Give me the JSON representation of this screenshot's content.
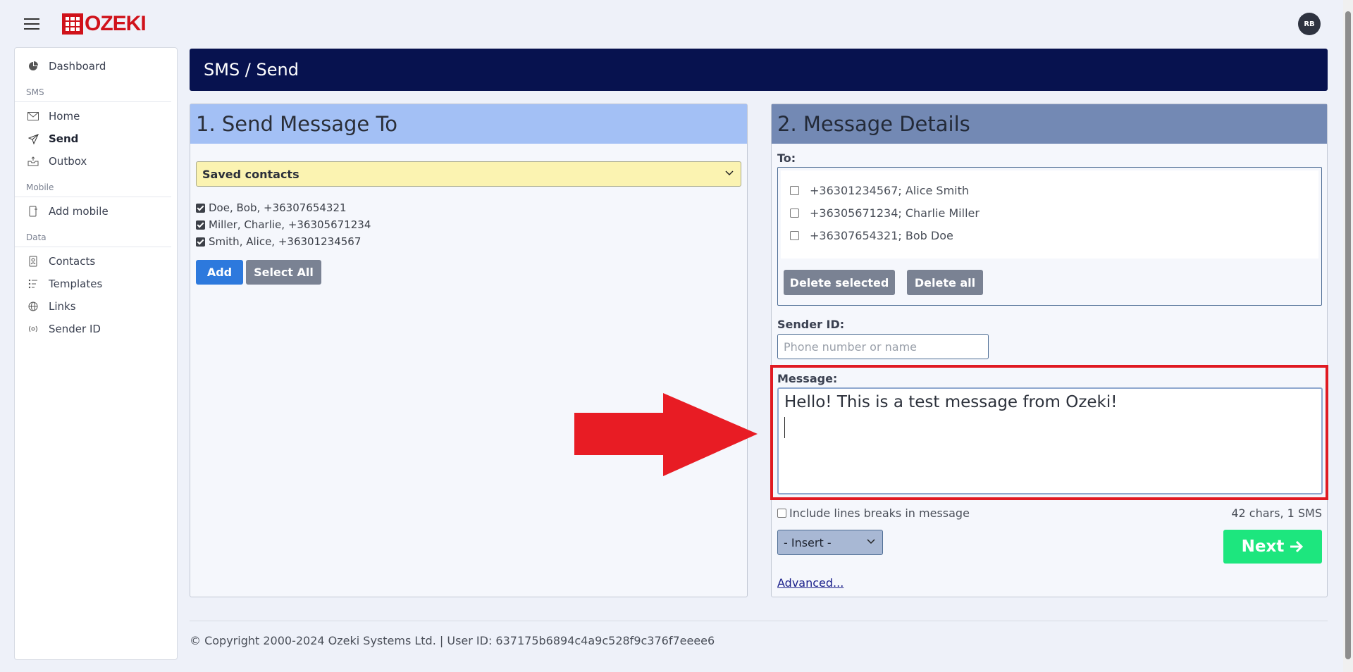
{
  "app": {
    "logo_text": "OZEKI",
    "avatar_initials": "RB"
  },
  "sidebar": {
    "dashboard": "Dashboard",
    "sections": {
      "sms": "SMS",
      "mobile": "Mobile",
      "data": "Data"
    },
    "items": {
      "home": "Home",
      "send": "Send",
      "outbox": "Outbox",
      "add_mobile": "Add mobile",
      "contacts": "Contacts",
      "templates": "Templates",
      "links": "Links",
      "sender_id": "Sender ID"
    }
  },
  "banner": {
    "title": "SMS / Send"
  },
  "panel1": {
    "title": "1. Send Message To",
    "dropdown_value": "Saved contacts",
    "contacts": [
      "Doe, Bob, +36307654321",
      "Miller, Charlie, +36305671234",
      "Smith, Alice, +36301234567"
    ],
    "add_label": "Add",
    "select_all_label": "Select All"
  },
  "panel2": {
    "title": "2. Message Details",
    "to_label": "To:",
    "recipients": [
      "+36301234567; Alice Smith",
      "+36305671234; Charlie Miller",
      "+36307654321; Bob Doe"
    ],
    "delete_selected_label": "Delete selected",
    "delete_all_label": "Delete all",
    "sender_label": "Sender ID:",
    "sender_placeholder": "Phone number or name",
    "message_label": "Message:",
    "message_text": "Hello! This is a test message from Ozeki!",
    "line_breaks_label": "Include lines breaks in message",
    "char_count": "42 chars, 1 SMS",
    "insert_label": "- Insert -",
    "next_label": "Next",
    "advanced_label": "Advanced..."
  },
  "footer": {
    "text": "© Copyright 2000-2024 Ozeki Systems Ltd. | User ID: 637175b6894c4a9c528f9c376f7eeee6"
  },
  "colors": {
    "banner": "#07124f",
    "panel1_header": "#a3c0f5",
    "panel2_header": "#7389b4",
    "next_button": "#1de67e",
    "highlight": "#e01a22"
  }
}
